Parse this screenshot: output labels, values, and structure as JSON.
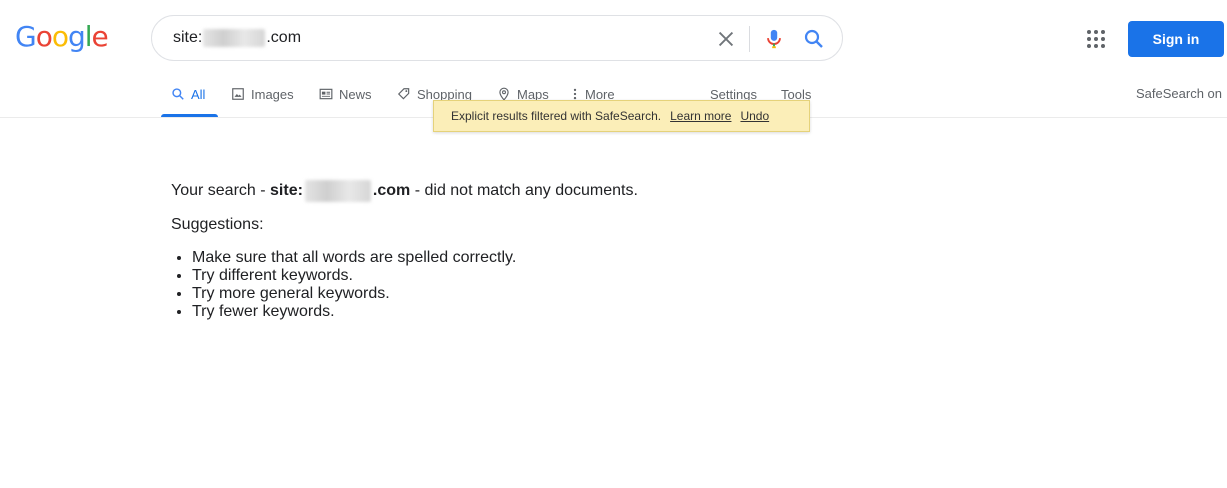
{
  "logo": {
    "letters": [
      "G",
      "o",
      "o",
      "g",
      "l",
      "e"
    ],
    "colors": [
      "#4285f4",
      "#ea4335",
      "#fbbc05",
      "#4285f4",
      "#34a853",
      "#ea4335"
    ]
  },
  "search": {
    "query_prefix": "site:",
    "query_suffix": ".com"
  },
  "header": {
    "sign_in_label": "Sign in",
    "apps_icon": "grid-icon"
  },
  "tabs": [
    {
      "label": "All",
      "icon": "search-icon",
      "active": true
    },
    {
      "label": "Images",
      "icon": "image-icon"
    },
    {
      "label": "News",
      "icon": "newspaper-icon"
    },
    {
      "label": "Shopping",
      "icon": "tag-icon"
    },
    {
      "label": "Maps",
      "icon": "map-pin-icon"
    },
    {
      "label": "More",
      "icon": "more-vert-icon"
    },
    {
      "label": "Settings"
    },
    {
      "label": "Tools"
    }
  ],
  "safesearch_label": "SafeSearch on",
  "notice": {
    "text": "Explicit results filtered with SafeSearch.",
    "learn_more": "Learn more",
    "undo": "Undo"
  },
  "results": {
    "prefix": "Your search - ",
    "term_prefix": "site:",
    "term_suffix": ".com",
    "suffix": " - did not match any documents.",
    "suggestions_title": "Suggestions:",
    "suggestions": [
      "Make sure that all words are spelled correctly.",
      "Try different keywords.",
      "Try more general keywords.",
      "Try fewer keywords."
    ]
  },
  "colors": {
    "accent": "#1a73e8",
    "notice_bg": "#fbeeb8",
    "text_secondary": "#5f6368"
  }
}
